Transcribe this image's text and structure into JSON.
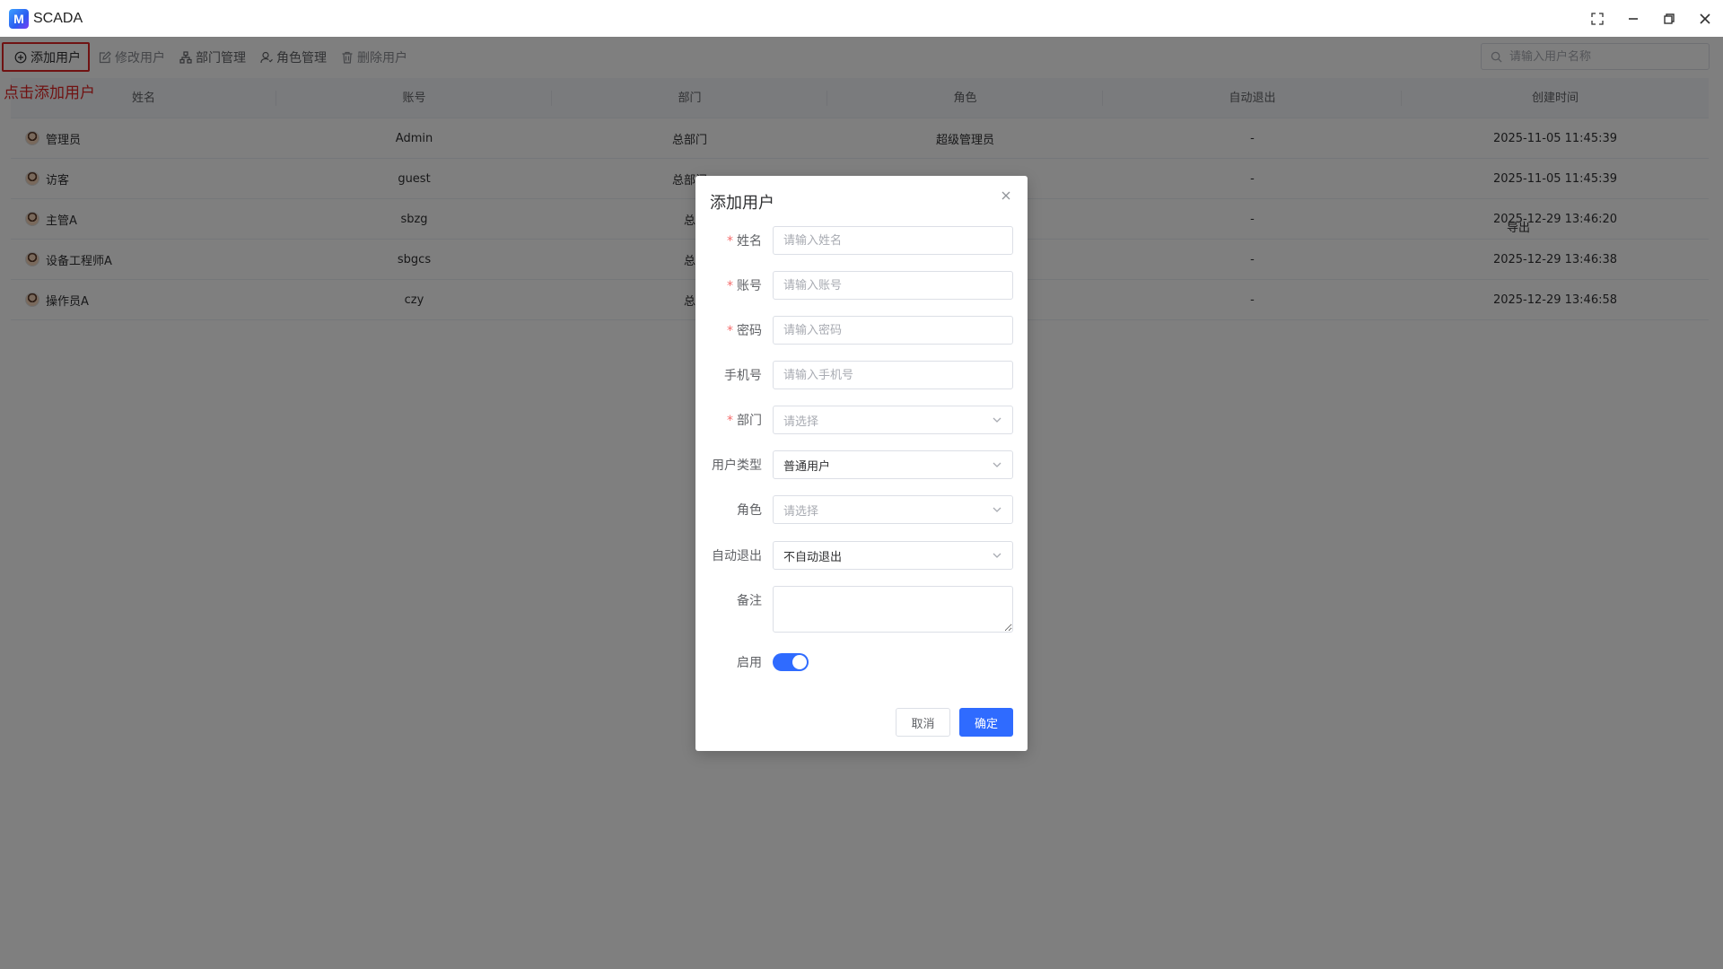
{
  "window": {
    "logo_letter": "M",
    "title": "SCADA"
  },
  "toolbar": {
    "add_user": "添加用户",
    "edit_user": "修改用户",
    "dept_manage": "部门管理",
    "role_manage": "角色管理",
    "delete_user": "删除用户"
  },
  "search": {
    "placeholder": "请输入用户名称"
  },
  "annotation": "点击添加用户",
  "table": {
    "headers": [
      "姓名",
      "账号",
      "部门",
      "角色",
      "自动退出",
      "创建时间"
    ],
    "rows": [
      {
        "name": "管理员",
        "account": "Admin",
        "dept": "总部门",
        "role": "超级管理员",
        "auto_logout": "-",
        "created": "2025-11-05 11:45:39"
      },
      {
        "name": "访客",
        "account": "guest",
        "dept": "总部门",
        "role": "",
        "auto_logout": "-",
        "created": "2025-11-05 11:45:39"
      },
      {
        "name": "主管A",
        "account": "sbzg",
        "dept": "总",
        "role": "",
        "auto_logout": "-",
        "created": "2025-12-29 13:46:20"
      },
      {
        "name": "设备工程师A",
        "account": "sbgcs",
        "dept": "总",
        "role": "",
        "auto_logout": "-",
        "created": "2025-12-29 13:46:38"
      },
      {
        "name": "操作员A",
        "account": "czy",
        "dept": "总",
        "role": "",
        "auto_logout": "-",
        "created": "2025-12-29 13:46:58"
      }
    ],
    "export_label": "导出"
  },
  "dialog": {
    "title": "添加用户",
    "fields": {
      "name": {
        "label": "姓名",
        "placeholder": "请输入姓名",
        "required": true
      },
      "account": {
        "label": "账号",
        "placeholder": "请输入账号",
        "required": true
      },
      "password": {
        "label": "密码",
        "placeholder": "请输入密码",
        "required": true
      },
      "phone": {
        "label": "手机号",
        "placeholder": "请输入手机号",
        "required": false
      },
      "dept": {
        "label": "部门",
        "placeholder": "请选择",
        "required": true
      },
      "user_type": {
        "label": "用户类型",
        "value": "普通用户"
      },
      "role": {
        "label": "角色",
        "placeholder": "请选择"
      },
      "auto_logout": {
        "label": "自动退出",
        "value": "不自动退出"
      },
      "remark": {
        "label": "备注",
        "value": ""
      },
      "enabled": {
        "label": "启用",
        "on": true
      }
    },
    "req_mark": "*",
    "cancel": "取消",
    "confirm": "确定"
  },
  "colors": {
    "primary": "#2f6bff",
    "annotation_red": "#e02424",
    "required_red": "#f56c6c"
  }
}
